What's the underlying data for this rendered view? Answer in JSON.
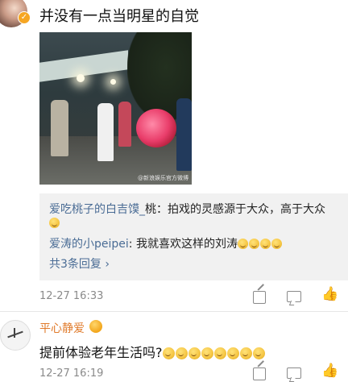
{
  "post1": {
    "comment": "并没有一点当明星的自觉",
    "photo_watermark": "@新浪娱乐官方微博",
    "replies": [
      {
        "user": "爱吃桃子的白吉馍_",
        "text": "桃：拍戏的灵感源于大众，高于大众"
      },
      {
        "user": "爱涛的小peipei",
        "text": "我就喜欢这样的刘涛"
      }
    ],
    "more_replies": "共3条回复",
    "more_chevron": "›",
    "timestamp": "12-27 16:33"
  },
  "post2": {
    "username": "平心静爱",
    "comment": "提前体验老年生活吗?",
    "timestamp": "12-27 16:19"
  },
  "icons": [
    "share-icon",
    "comment-icon",
    "like-icon",
    "verified-badge-icon",
    "laugh-emoji-icon",
    "member-badge-icon"
  ],
  "colors": {
    "username": "#4a6c95",
    "username_alt": "#e07a2a",
    "meta": "#8a8a8a",
    "reply_bg": "#f1f1f1"
  }
}
